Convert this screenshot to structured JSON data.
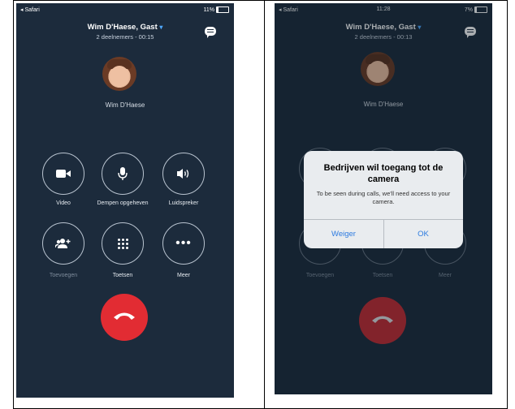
{
  "left_screen": {
    "status": {
      "carrier": "◂ Safari",
      "battery": "11%"
    },
    "header": {
      "title": "Wim D'Haese, Gast",
      "subtitle": "2 deelnemers - 00:15"
    },
    "caller_name": "Wim D'Haese",
    "controls": [
      {
        "label": "Video",
        "icon": "video-camera-icon"
      },
      {
        "label": "Dempen opgeheven",
        "icon": "microphone-icon"
      },
      {
        "label": "Luidspreker",
        "icon": "speaker-icon"
      },
      {
        "label": "Toevoegen",
        "icon": "add-person-icon",
        "disabled": true
      },
      {
        "label": "Toetsen",
        "icon": "dialpad-icon"
      },
      {
        "label": "Meer",
        "icon": "more-icon"
      }
    ]
  },
  "right_screen": {
    "status": {
      "carrier": "◂ Safari",
      "time": "11:28",
      "battery": "7%"
    },
    "header": {
      "title": "Wim D'Haese, Gast",
      "subtitle": "2 deelnemers - 00:13"
    },
    "caller_name": "Wim D'Haese",
    "controls": [
      {
        "label": "Toevoegen"
      },
      {
        "label": "Toetsen"
      },
      {
        "label": "Meer"
      }
    ],
    "dialog": {
      "title": "Bedrijven wil toegang tot de camera",
      "message": "To be seen during calls, we'll need access to your camera.",
      "deny": "Weiger",
      "ok": "OK"
    }
  },
  "colors": {
    "background": "#1c2b3c",
    "hangup": "#e22c33",
    "dialog_button": "#2d7be0"
  }
}
